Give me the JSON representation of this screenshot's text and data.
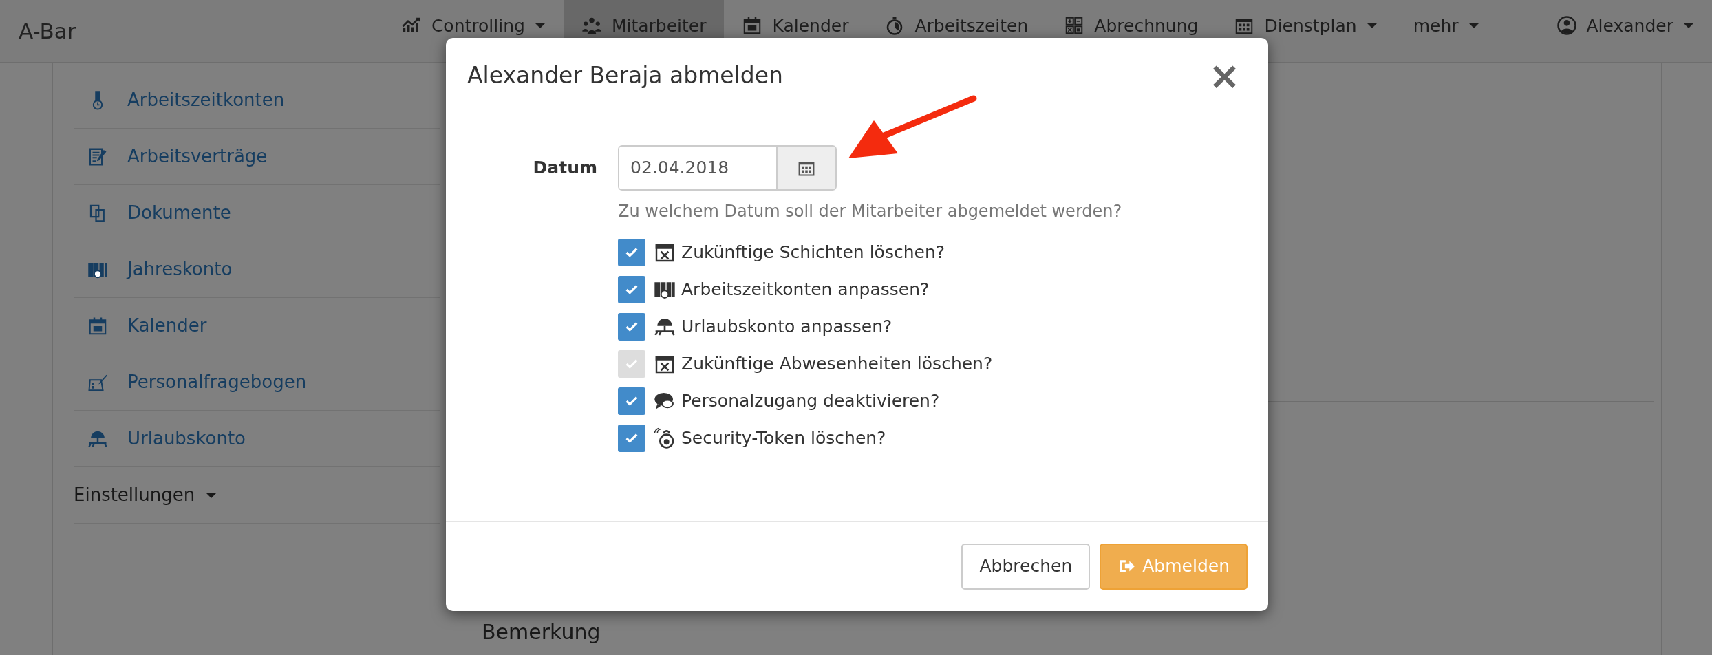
{
  "navbar": {
    "brand": "A-Bar",
    "items": [
      {
        "label": "Controlling",
        "dropdown": true,
        "selected": false
      },
      {
        "label": "Mitarbeiter",
        "dropdown": false,
        "selected": true
      },
      {
        "label": "Kalender",
        "dropdown": false,
        "selected": false
      },
      {
        "label": "Arbeitszeiten",
        "dropdown": false,
        "selected": false
      },
      {
        "label": "Abrechnung",
        "dropdown": false,
        "selected": false
      },
      {
        "label": "Dienstplan",
        "dropdown": true,
        "selected": false
      },
      {
        "label": "mehr",
        "dropdown": true,
        "selected": false
      }
    ],
    "user": {
      "label": "Alexander",
      "dropdown": true
    }
  },
  "sidebar": {
    "items": [
      {
        "label": "Arbeitszeitkonten"
      },
      {
        "label": "Arbeitsverträge"
      },
      {
        "label": "Dokumente"
      },
      {
        "label": "Jahreskonto"
      },
      {
        "label": "Kalender"
      },
      {
        "label": "Personalfragebogen"
      },
      {
        "label": "Urlaubskonto"
      }
    ],
    "settings": {
      "label": "Einstellungen",
      "dropdown": true
    }
  },
  "background": {
    "section_heading": "Bemerkung"
  },
  "modal": {
    "title": "Alexander Beraja abmelden",
    "close": "×",
    "date": {
      "label": "Datum",
      "value": "02.04.2018",
      "help": "Zu welchem Datum soll der Mitarbeiter abgemeldet werden?"
    },
    "options": [
      {
        "label": "Zukünftige Schichten löschen?",
        "checked": true,
        "disabled": false
      },
      {
        "label": "Arbeitszeitkonten anpassen?",
        "checked": true,
        "disabled": false
      },
      {
        "label": "Urlaubskonto anpassen?",
        "checked": true,
        "disabled": false
      },
      {
        "label": "Zukünftige Abwesenheiten löschen?",
        "checked": true,
        "disabled": true
      },
      {
        "label": "Personalzugang deaktivieren?",
        "checked": true,
        "disabled": false
      },
      {
        "label": "Security-Token löschen?",
        "checked": true,
        "disabled": false
      }
    ],
    "buttons": [
      {
        "label": "Abbrechen",
        "kind": "secondary"
      },
      {
        "label": "Abmelden",
        "kind": "primary"
      }
    ]
  }
}
